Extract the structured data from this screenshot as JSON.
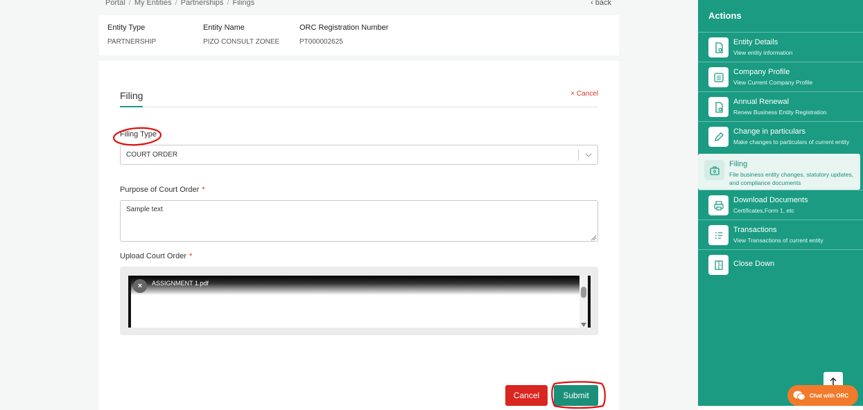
{
  "breadcrumb": [
    "Portal",
    "My Entities",
    "Partnerships",
    "Filings"
  ],
  "back_label": "back",
  "entity": {
    "type_label": "Entity Type",
    "type_value": "PARTNERSHIP",
    "name_label": "Entity Name",
    "name_value": "PIZO CONSULT ZONEE",
    "orc_label": "ORC Registration Number",
    "orc_value": "PT000002625"
  },
  "form": {
    "tab_label": "Filing",
    "cancel_link": "× Cancel",
    "filing_type_label": "Filing Type",
    "filing_type_value": "COURT ORDER",
    "purpose_label": "Purpose of Court Order",
    "purpose_required": "*",
    "purpose_value": "Sample text",
    "upload_label": "Upload Court Order",
    "upload_required": "*",
    "file_name": "ASSIGNMENT 1.pdf",
    "file_remove": "×",
    "cancel_button": "Cancel",
    "submit_button": "Submit"
  },
  "sidebar": {
    "title": "Actions",
    "items": [
      {
        "title": "Entity Details",
        "desc": "View entity information",
        "icon": "file-eye-icon"
      },
      {
        "title": "Company Profile",
        "desc": "View Current Company Profile",
        "icon": "list-icon"
      },
      {
        "title": "Annual Renewal",
        "desc": "Renew Business Entity Registration",
        "icon": "file-refresh-icon"
      },
      {
        "title": "Change in particulars",
        "desc": "Make changes to particulars of current entity",
        "icon": "pencil-icon"
      },
      {
        "title": "Filing",
        "desc": "File business entity changes, statutory updates, and compliance documents",
        "icon": "briefcase-icon",
        "active": true
      },
      {
        "title": "Download Documents",
        "desc": "Certificates,Form 1, etc",
        "icon": "printer-icon"
      },
      {
        "title": "Transactions",
        "desc": "View Transactions of current entity",
        "icon": "transactions-icon"
      },
      {
        "title": "Close Down",
        "desc": "",
        "icon": "door-icon"
      }
    ]
  },
  "chat_label": "Chat with ORC",
  "colors": {
    "accent": "#1a9b82",
    "submit": "#1a8f79",
    "cancel": "#d92620",
    "chat": "#f27a2b",
    "annotation": "#e01010"
  }
}
